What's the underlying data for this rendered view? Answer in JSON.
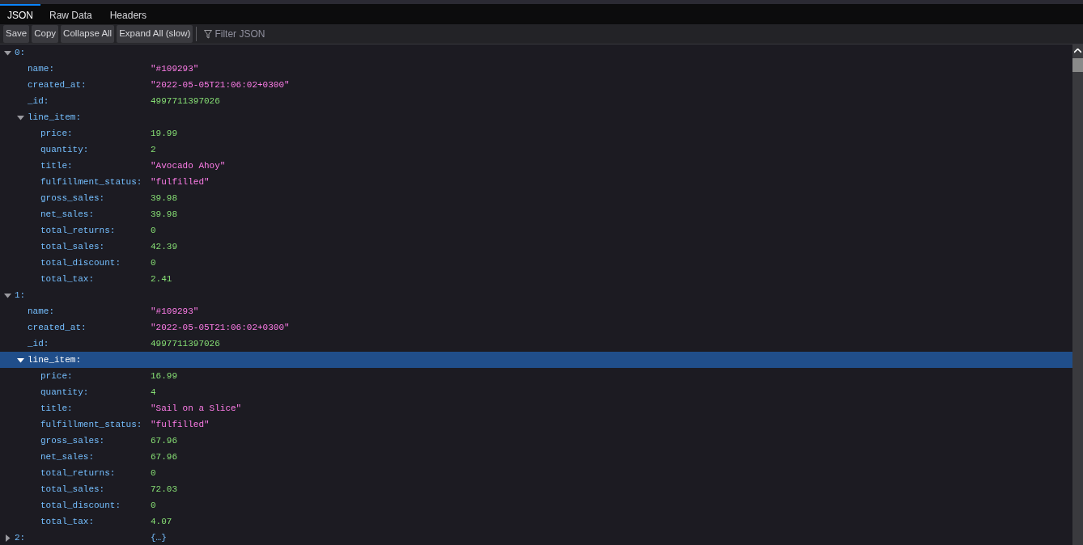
{
  "tabs": [
    {
      "label": "JSON",
      "selected": true
    },
    {
      "label": "Raw Data",
      "selected": false
    },
    {
      "label": "Headers",
      "selected": false
    }
  ],
  "toolbar": {
    "buttons": [
      "Save",
      "Copy",
      "Collapse All",
      "Expand All (slow)"
    ],
    "filter": {
      "placeholder": "Filter JSON"
    }
  },
  "tree": [
    {
      "key": "0:",
      "expanded": true,
      "selected": false,
      "children": [
        {
          "key": "name:",
          "value": "\"#109293\"",
          "kind": "string"
        },
        {
          "key": "created_at:",
          "value": "\"2022-05-05T21:06:02+0300\"",
          "kind": "string"
        },
        {
          "key": "_id:",
          "value": "4997711397026",
          "kind": "number"
        },
        {
          "key": "line_item:",
          "expanded": true,
          "selected": false,
          "children": [
            {
              "key": "price:",
              "value": "19.99",
              "kind": "number"
            },
            {
              "key": "quantity:",
              "value": "2",
              "kind": "number"
            },
            {
              "key": "title:",
              "value": "\"Avocado Ahoy\"",
              "kind": "string"
            },
            {
              "key": "fulfillment_status:",
              "value": "\"fulfilled\"",
              "kind": "string"
            },
            {
              "key": "gross_sales:",
              "value": "39.98",
              "kind": "number"
            },
            {
              "key": "net_sales:",
              "value": "39.98",
              "kind": "number"
            },
            {
              "key": "total_returns:",
              "value": "0",
              "kind": "number"
            },
            {
              "key": "total_sales:",
              "value": "42.39",
              "kind": "number"
            },
            {
              "key": "total_discount:",
              "value": "0",
              "kind": "number"
            },
            {
              "key": "total_tax:",
              "value": "2.41",
              "kind": "number"
            }
          ]
        }
      ]
    },
    {
      "key": "1:",
      "expanded": true,
      "selected": false,
      "children": [
        {
          "key": "name:",
          "value": "\"#109293\"",
          "kind": "string"
        },
        {
          "key": "created_at:",
          "value": "\"2022-05-05T21:06:02+0300\"",
          "kind": "string"
        },
        {
          "key": "_id:",
          "value": "4997711397026",
          "kind": "number"
        },
        {
          "key": "line_item:",
          "expanded": true,
          "selected": true,
          "children": [
            {
              "key": "price:",
              "value": "16.99",
              "kind": "number"
            },
            {
              "key": "quantity:",
              "value": "4",
              "kind": "number"
            },
            {
              "key": "title:",
              "value": "\"Sail on a Slice\"",
              "kind": "string"
            },
            {
              "key": "fulfillment_status:",
              "value": "\"fulfilled\"",
              "kind": "string"
            },
            {
              "key": "gross_sales:",
              "value": "67.96",
              "kind": "number"
            },
            {
              "key": "net_sales:",
              "value": "67.96",
              "kind": "number"
            },
            {
              "key": "total_returns:",
              "value": "0",
              "kind": "number"
            },
            {
              "key": "total_sales:",
              "value": "72.03",
              "kind": "number"
            },
            {
              "key": "total_discount:",
              "value": "0",
              "kind": "number"
            },
            {
              "key": "total_tax:",
              "value": "4.07",
              "kind": "number"
            }
          ]
        }
      ]
    },
    {
      "key": "2:",
      "value": "{…}",
      "kind": "collapsed",
      "expanded": false,
      "selected": false
    }
  ]
}
